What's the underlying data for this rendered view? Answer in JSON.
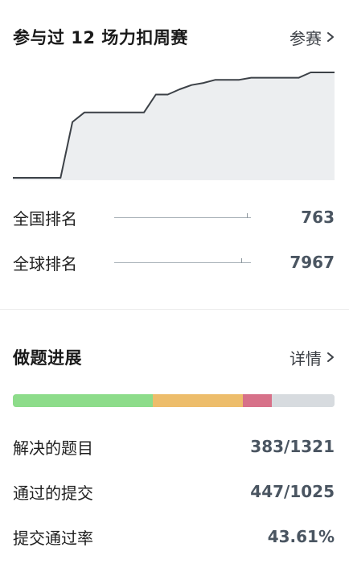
{
  "contest": {
    "title": "参与过 12 场力扣周赛",
    "link_label": "参赛",
    "chart_data": {
      "type": "area",
      "title": "",
      "xlabel": "",
      "ylabel": "",
      "series": [
        {
          "values": [
            0.0,
            0.0,
            0.0,
            0.0,
            0.0,
            0.53,
            0.62,
            0.62,
            0.62,
            0.62,
            0.62,
            0.62,
            0.79,
            0.79,
            0.84,
            0.88,
            0.9,
            0.93,
            0.93,
            0.93,
            0.95,
            0.95,
            0.95,
            0.95,
            0.95,
            1.0,
            1.0,
            1.0
          ]
        }
      ],
      "ylim": [
        0,
        1
      ],
      "grid": false,
      "colors": {
        "line": "#3c4147",
        "fill": "#eceef0"
      }
    },
    "ranks": [
      {
        "label": "全国排名",
        "value": "763",
        "marker_position": 0.97
      },
      {
        "label": "全球排名",
        "value": "7967",
        "marker_position": 0.93
      }
    ]
  },
  "progress": {
    "title": "做题进展",
    "link_label": "详情",
    "bar_segments": [
      {
        "name": "easy",
        "fraction": 0.435,
        "color": "#8ddc8a"
      },
      {
        "name": "medium",
        "fraction": 0.28,
        "color": "#edbd6b"
      },
      {
        "name": "hard",
        "fraction": 0.09,
        "color": "#d77189"
      },
      {
        "name": "remaining",
        "fraction": 0.195,
        "color": "#d7dbdf"
      }
    ],
    "stats": [
      {
        "label": "解决的题目",
        "value": "383/1321"
      },
      {
        "label": "通过的提交",
        "value": "447/1025"
      },
      {
        "label": "提交通过率",
        "value": "43.61%"
      }
    ]
  }
}
